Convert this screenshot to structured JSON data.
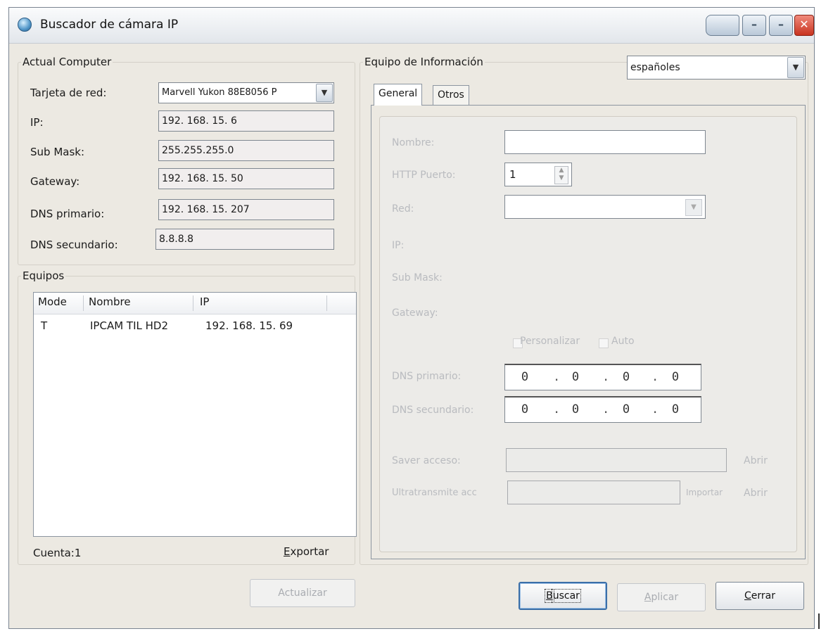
{
  "window": {
    "title": "Buscador de cámara IP",
    "controls": {
      "minimize_1": "–",
      "minimize_2": "–",
      "close": "✕"
    }
  },
  "actual_computer": {
    "legend": "Actual Computer",
    "rows": [
      {
        "label": "Tarjeta de red:",
        "value": "Marvell Yukon 88E8056 P"
      },
      {
        "label": "IP:",
        "value": "192. 168. 15. 6"
      },
      {
        "label": "Sub Mask:",
        "value": "255.255.255.0"
      },
      {
        "label": "Gateway:",
        "value": "192. 168. 15. 50"
      },
      {
        "label": "DNS primario:",
        "value": "192. 168. 15. 207"
      },
      {
        "label": "DNS secundario:",
        "value": "8.8.8.8"
      }
    ]
  },
  "equipos": {
    "legend": "Equipos",
    "columns": [
      "Mode",
      "Nombre",
      "IP"
    ],
    "rows": [
      {
        "mode": "T",
        "nombre": "IPCAM TIL HD2",
        "ip": "192. 168. 15. 69"
      }
    ],
    "count_label": "Cuenta:1",
    "export_label": "Exportar",
    "export_label_first": "E",
    "export_label_rest": "xportar"
  },
  "info": {
    "legend": "Equipo de Información",
    "language": "españoles",
    "tabs": [
      "General",
      "Otros"
    ],
    "active_tab": "General",
    "labels": {
      "nombre": "Nombre:",
      "http_puerto": "HTTP Puerto:",
      "red": "Red:",
      "ip": "IP:",
      "sub_mask": "Sub Mask:",
      "gateway": "Gateway:",
      "personalizar": "Personalizar",
      "auto": "Auto",
      "dns_primario": "DNS primario:",
      "dns_secundario": "DNS secundario:",
      "fs_label_1": "Saver acceso:",
      "fs_label_2": "Ultratransmite acc",
      "abrir": "Abrir",
      "importar": "Importar"
    },
    "values": {
      "nombre": "",
      "http_puerto": "1",
      "dns_primario": [
        "0",
        "0",
        "0",
        "0"
      ],
      "dns_secundario": [
        "0",
        "0",
        "0",
        "0"
      ]
    }
  },
  "buttons": {
    "actualizar": "Actualizar",
    "buscar_first": "B",
    "buscar_rest": "uscar",
    "aplicar_first": "A",
    "aplicar_rest": "plicar",
    "cerrar_first": "C",
    "cerrar_rest": "errar"
  },
  "colors": {
    "window_bg": "#ece9e2",
    "disabled_text": "#b9bbbf",
    "focus_border": "#3b6fa8"
  }
}
